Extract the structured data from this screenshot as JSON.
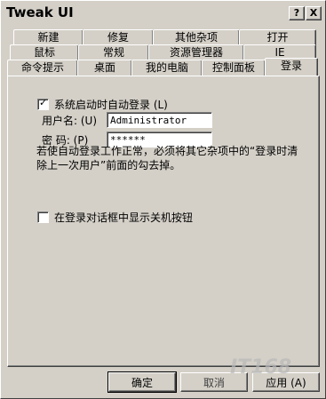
{
  "window": {
    "title": "Tweak UI",
    "help_glyph": "?",
    "close_glyph": "X"
  },
  "tabs": {
    "row1": [
      "新建",
      "修复",
      "其他杂项",
      "打开"
    ],
    "row2": [
      "鼠标",
      "常规",
      "资源管理器",
      "IE"
    ],
    "row3": [
      "命令提示",
      "桌面",
      "我的电脑",
      "控制面板",
      "登录"
    ],
    "active": "登录"
  },
  "login": {
    "autologon_label": "系统启动时自动登录 (L)",
    "autologon_checked": true,
    "username_label": "用户名: (U)",
    "username_value": "Administrator",
    "password_label": "密  码: (P)",
    "password_value": "******",
    "note": "若使自动登录工作正常，必须将其它杂项中的“登录时清除上一次用户”前面的勾去掉。",
    "shutdown_label": "在登录对话框中显示关机按钮",
    "shutdown_checked": false
  },
  "buttons": {
    "ok": "确定",
    "cancel": "取消",
    "apply": "应用 (A)"
  },
  "watermark": "IT168"
}
